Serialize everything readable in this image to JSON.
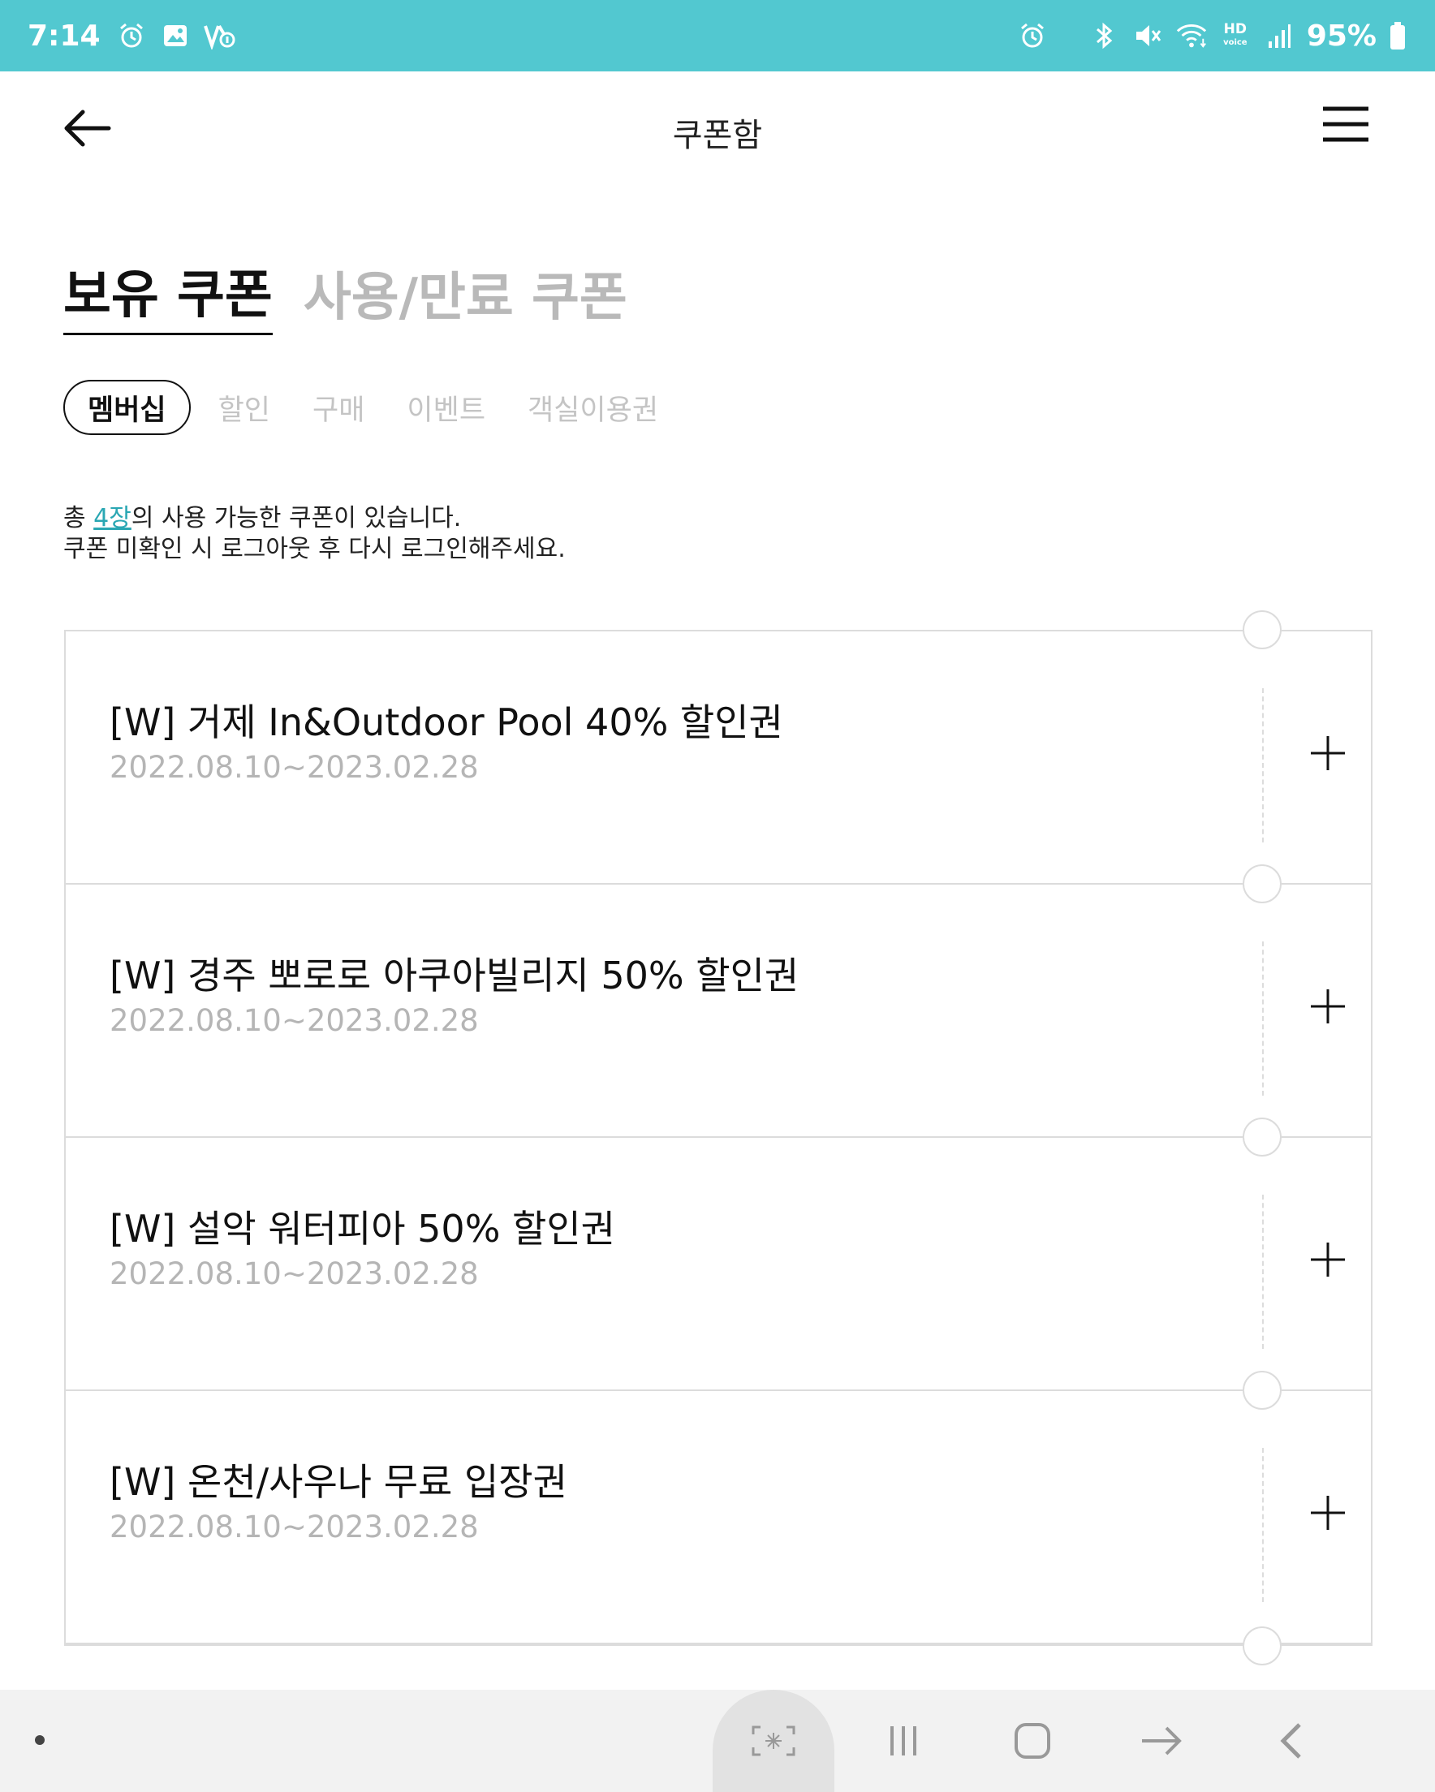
{
  "status_bar": {
    "time": "7:14",
    "battery": "95%",
    "hd_line1": "HD",
    "hd_line2": "voice",
    "icons_left": [
      "alarm-icon",
      "gallery-icon",
      "volte-icon"
    ],
    "icons_right": [
      "alarm-icon",
      "bluetooth-icon",
      "mute-icon",
      "wifi-icon",
      "hd-voice-icon",
      "signal-icon",
      "battery-icon"
    ]
  },
  "header": {
    "title": "쿠폰함",
    "back_icon": "arrow-left-icon",
    "menu_icon": "hamburger-menu-icon"
  },
  "main_tabs": [
    {
      "label": "보유 쿠폰",
      "active": true
    },
    {
      "label": "사용/만료 쿠폰",
      "active": false
    }
  ],
  "category_chips": [
    {
      "label": "멤버십",
      "active": true
    },
    {
      "label": "할인",
      "active": false
    },
    {
      "label": "구매",
      "active": false
    },
    {
      "label": "이벤트",
      "active": false
    },
    {
      "label": "객실이용권",
      "active": false
    }
  ],
  "info": {
    "line1_prefix": "총 ",
    "count": "4장",
    "line1_suffix": "의 사용 가능한 쿠폰이 있습니다.",
    "line2": "쿠폰 미확인 시 로그아웃 후 다시 로그인해주세요."
  },
  "coupons": [
    {
      "title": "[W] 거제 In&Outdoor Pool 40% 할인권",
      "period": "2022.08.10~2023.02.28"
    },
    {
      "title": "[W] 경주 뽀로로 아쿠아빌리지 50% 할인권",
      "period": "2022.08.10~2023.02.28"
    },
    {
      "title": "[W] 설악 워터피아 50% 할인권",
      "period": "2022.08.10~2023.02.28"
    },
    {
      "title": "[W] 온천/사우나 무료 입장권",
      "period": "2022.08.10~2023.02.28"
    }
  ],
  "nav_bar": {
    "buttons": [
      "screen-capture-icon",
      "recents-icon",
      "home-icon",
      "forward-icon",
      "back-icon"
    ]
  },
  "colors": {
    "status_bar": "#52c8d0",
    "accent": "#2aa7b3",
    "inactive_text": "#b9b9b9",
    "border": "#dcdcdc"
  }
}
